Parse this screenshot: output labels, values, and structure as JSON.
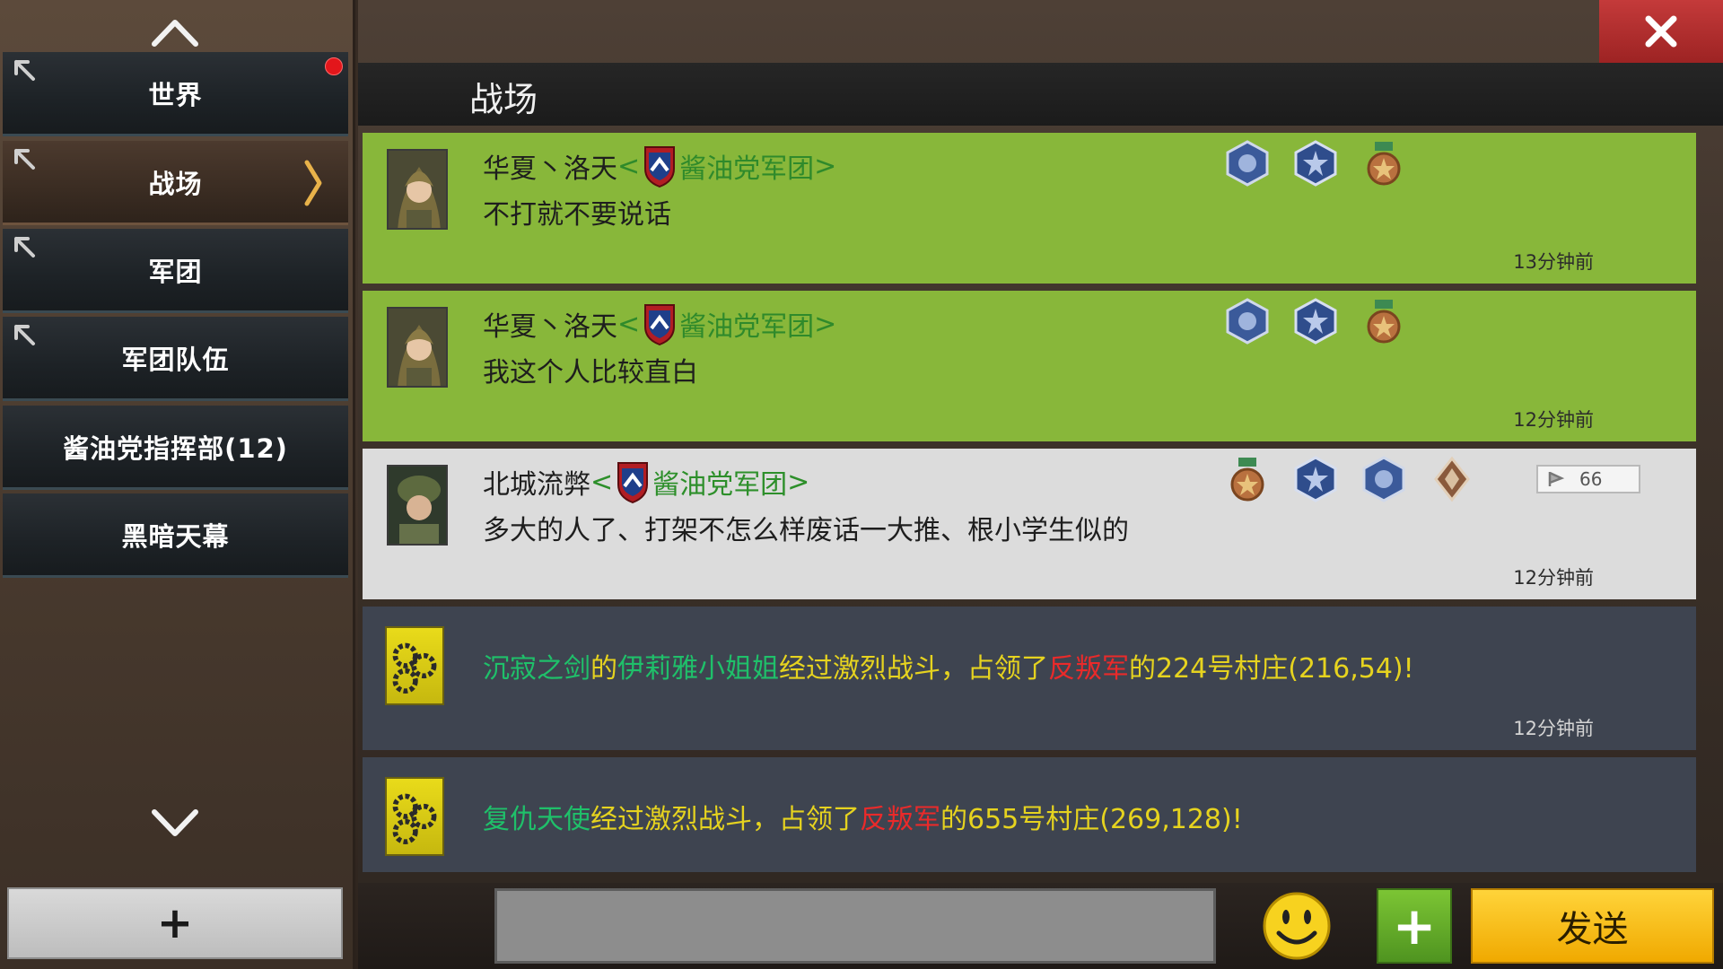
{
  "sidebar": {
    "tabs": [
      {
        "label": "世界",
        "pinned": true,
        "has_notification": true
      },
      {
        "label": "战场",
        "pinned": true,
        "active": true
      },
      {
        "label": "军团",
        "pinned": true
      },
      {
        "label": "军团队伍",
        "pinned": true
      },
      {
        "label": "酱油党指挥部(12)"
      },
      {
        "label": "黑暗天幕"
      }
    ],
    "add_label": "+"
  },
  "header": {
    "title": "战场"
  },
  "messages": [
    {
      "kind": "player",
      "bg": "green",
      "name": "华夏丶洛天",
      "guild_open": "<",
      "guild": "酱油党军团",
      "guild_close": ">",
      "text": "不打就不要说话",
      "time": "13分钟前",
      "medals": [
        "blue-wing-medal-icon",
        "blue-star-medal-icon",
        "bronze-star-medal-icon"
      ]
    },
    {
      "kind": "player",
      "bg": "green",
      "name": "华夏丶洛天",
      "guild_open": "<",
      "guild": "酱油党军团",
      "guild_close": ">",
      "text": "我这个人比较直白",
      "time": "12分钟前",
      "medals": [
        "blue-wing-medal-icon",
        "blue-star-medal-icon",
        "bronze-star-medal-icon"
      ]
    },
    {
      "kind": "player",
      "bg": "grey",
      "name": "北城流弊",
      "guild_open": "<",
      "guild": "酱油党军团",
      "guild_close": ">",
      "text": "多大的人了、打架不怎么样废话一大推、根小学生似的",
      "time": "12分钟前",
      "medals": [
        "bronze-star-medal-icon",
        "blue-star-medal-icon",
        "blue-wing-medal-icon",
        "rank-diamond-icon"
      ],
      "likes": "66"
    },
    {
      "kind": "system",
      "parts": [
        {
          "t": "沉寂之剑",
          "c": "p"
        },
        {
          "t": "的",
          "c": ""
        },
        {
          "t": "伊莉雅小姐姐",
          "c": "p"
        },
        {
          "t": "经过激烈战斗，占领了",
          "c": ""
        },
        {
          "t": "反叛军",
          "c": "r"
        },
        {
          "t": "的224号村庄(216,54)!",
          "c": ""
        }
      ],
      "time": "12分钟前"
    },
    {
      "kind": "system",
      "parts": [
        {
          "t": "复仇天使",
          "c": "p"
        },
        {
          "t": "经过激烈战斗，占领了",
          "c": ""
        },
        {
          "t": "反叛军",
          "c": "r"
        },
        {
          "t": "的655号村庄(269,128)!",
          "c": ""
        }
      ],
      "time": ""
    }
  ],
  "input": {
    "placeholder": "",
    "value": ""
  },
  "buttons": {
    "send": "发送",
    "attach": "+"
  },
  "colors": {
    "green_bg": "#88b73a",
    "player_name": "#2f8a2b",
    "system_player": "#1fc06a",
    "rebel": "#ea2a2a",
    "system_text": "#e6d31f"
  }
}
